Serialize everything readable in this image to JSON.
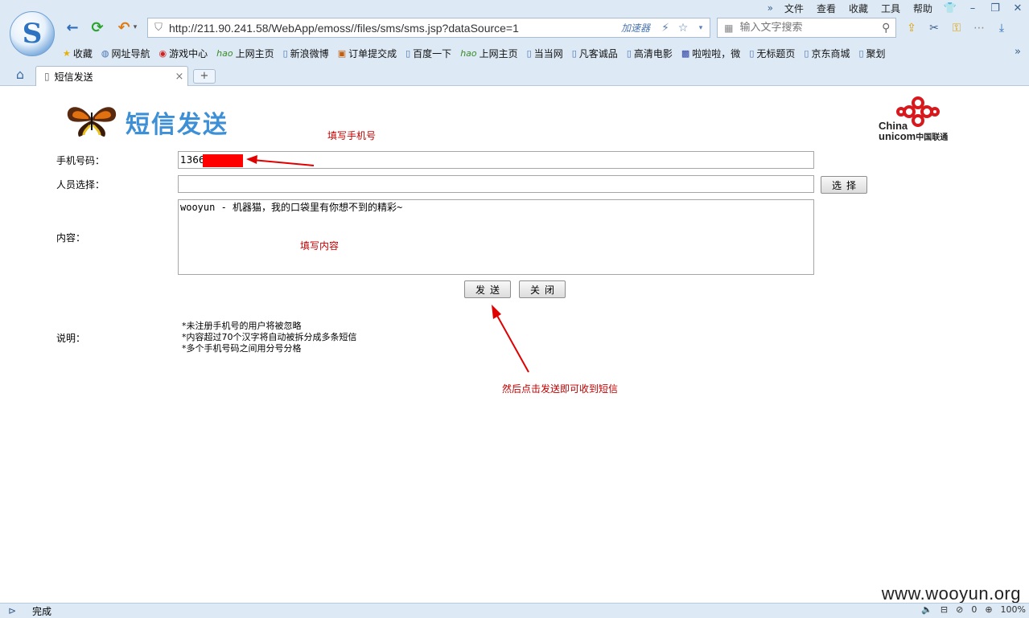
{
  "browser": {
    "menu": [
      "文件",
      "查看",
      "收藏",
      "工具",
      "帮助"
    ],
    "url": "http://211.90.241.58/WebApp/emoss//files/sms/sms.jsp?dataSource=1",
    "accelerator_label": "加速器",
    "search_placeholder": "输入文字搜索",
    "favorites": [
      "收藏",
      "网址导航",
      "游戏中心",
      "上网主页",
      "新浪微博",
      "订单提交成",
      "百度一下",
      "上网主页",
      "当当网",
      "凡客诚品",
      "高清电影",
      "啦啦啦，微",
      "无标题页",
      "京东商城",
      "聚划"
    ],
    "tab_title": "短信发送",
    "status_text": "完成",
    "status_counter": "0",
    "zoom": "100%"
  },
  "page": {
    "title": "短信发送",
    "brand_line1": "China",
    "brand_line2": "unicom",
    "brand_cn": "中国联通",
    "phone_label": "手机号码：",
    "phone_value": "1366",
    "person_label": "人员选择：",
    "select_button": "选择",
    "content_label": "内容：",
    "content_value": "wooyun - 机器猫，我的口袋里有你想不到的精彩~",
    "send_button": "发送",
    "close_button": "关闭",
    "notes_label": "说明：",
    "notes": [
      "*未注册手机号的用户将被忽略",
      "*内容超过70个汉字将自动被拆分成多条短信",
      "*多个手机号码之间用分号分格"
    ]
  },
  "annotations": {
    "phone_hint": "填写手机号",
    "content_hint": "填写内容",
    "send_hint": "然后点击发送即可收到短信",
    "color": "#c00000"
  },
  "watermark": "www.wooyun.org"
}
